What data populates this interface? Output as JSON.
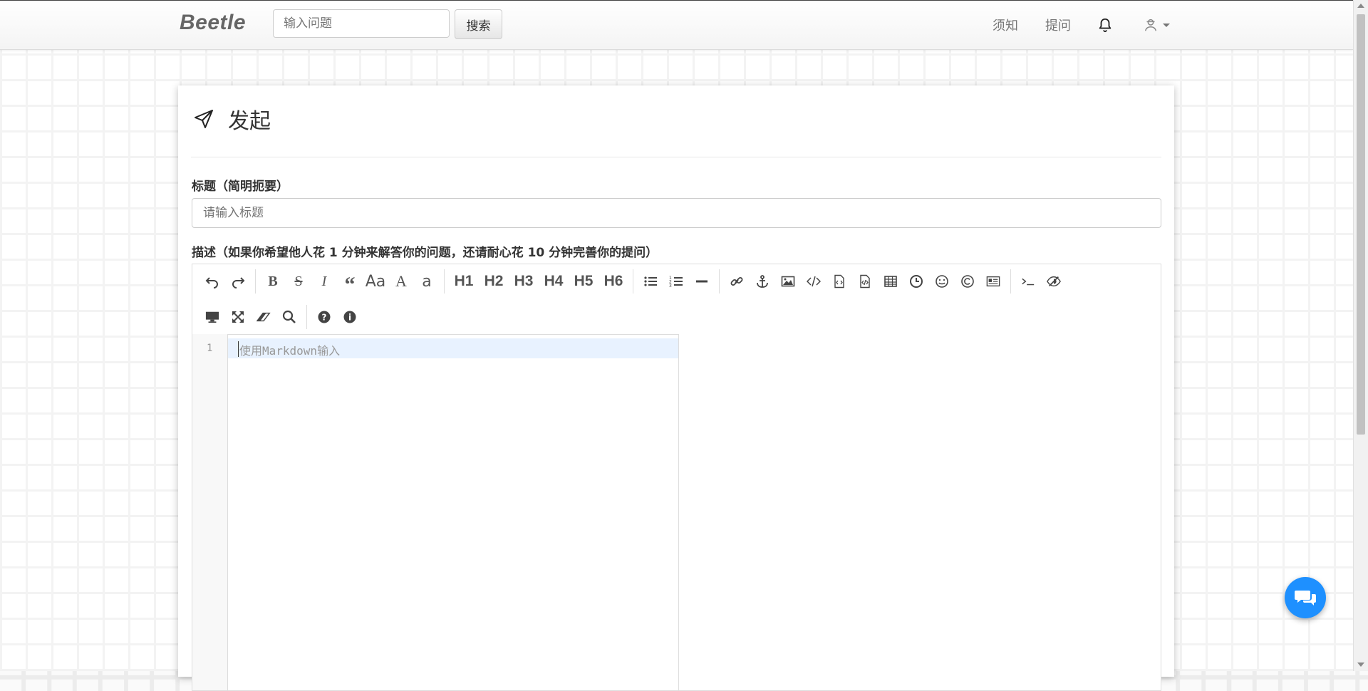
{
  "nav": {
    "brand": "Beetle",
    "search_placeholder": "输入问题",
    "search_button": "搜索",
    "links": [
      "须知",
      "提问"
    ]
  },
  "page": {
    "title": "发起",
    "title_field_label": "标题（简明扼要）",
    "title_field_placeholder": "请输入标题",
    "desc_label": "描述（如果你希望他人花 1 分钟来解答你的问题，还请耐心花 10 分钟完善你的提问）"
  },
  "editor": {
    "toolbar_row1": [
      {
        "icon": "undo-icon"
      },
      {
        "icon": "redo-icon"
      },
      {
        "sep": true
      },
      {
        "icon": "bold-icon"
      },
      {
        "icon": "strikethrough-icon"
      },
      {
        "icon": "italic-icon"
      },
      {
        "icon": "quote-icon"
      },
      {
        "icon": "uppercase-icon",
        "text": "Aa"
      },
      {
        "icon": "uppercase-a-icon",
        "text": "A"
      },
      {
        "icon": "lowercase-a-icon",
        "text": "a"
      },
      {
        "sep": true
      },
      {
        "text": "H1"
      },
      {
        "text": "H2"
      },
      {
        "text": "H3"
      },
      {
        "text": "H4"
      },
      {
        "text": "H5"
      },
      {
        "text": "H6"
      },
      {
        "sep": true
      },
      {
        "icon": "unordered-list-icon"
      },
      {
        "icon": "ordered-list-icon"
      },
      {
        "icon": "horizontal-rule-icon"
      },
      {
        "sep": true
      },
      {
        "icon": "link-icon"
      },
      {
        "icon": "anchor-icon"
      },
      {
        "icon": "image-icon"
      },
      {
        "icon": "code-icon"
      },
      {
        "icon": "code-block-icon"
      },
      {
        "icon": "pre-code-icon"
      },
      {
        "icon": "table-icon"
      },
      {
        "icon": "datetime-icon"
      },
      {
        "icon": "emoji-icon"
      },
      {
        "icon": "html-entities-icon"
      },
      {
        "icon": "pagebreak-icon"
      },
      {
        "sep": true
      },
      {
        "icon": "terminal-icon"
      },
      {
        "icon": "hide-preview-icon"
      }
    ],
    "toolbar_row2": [
      "desktop-icon",
      "fullscreen-icon",
      "eraser-icon",
      "search-icon",
      "sep",
      "help-icon",
      "info-icon"
    ],
    "line_number": "1",
    "placeholder": "使用Markdown输入"
  },
  "colors": {
    "accent": "#1e90ff",
    "active_line": "#e8f2ff"
  }
}
